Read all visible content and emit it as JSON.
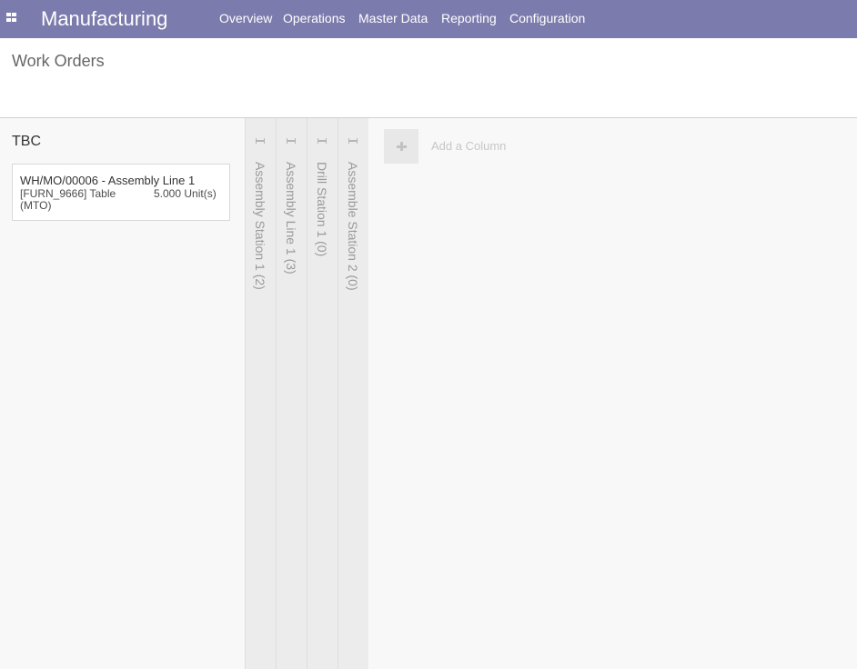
{
  "app": {
    "brand": "Manufacturing",
    "nav": [
      "Overview",
      "Operations",
      "Master Data",
      "Reporting",
      "Configuration"
    ]
  },
  "page": {
    "breadcrumb": "Work Orders"
  },
  "kanban": {
    "groups": [
      {
        "title": "TBC",
        "cards": [
          {
            "title": "WH/MO/00006 - Assembly Line 1",
            "product": "[FURN_9666] Table (MTO)",
            "quantity": "5.000 Unit(s)"
          }
        ]
      }
    ],
    "folded_columns": [
      "Assembly Station 1 (2)",
      "Assembly Line 1 (3)",
      "Drill Station 1 (0)",
      "Assemble Station 2 (0)"
    ],
    "add_column_label": "Add a Column"
  },
  "colors": {
    "navbar": "#7c7bad",
    "background": "#f8f8f8",
    "folded_column": "#ececec"
  },
  "icons": {
    "apps": "apps-grid-icon",
    "fold_handle": "unfold-handle-icon",
    "add_column": "plus-icon"
  }
}
